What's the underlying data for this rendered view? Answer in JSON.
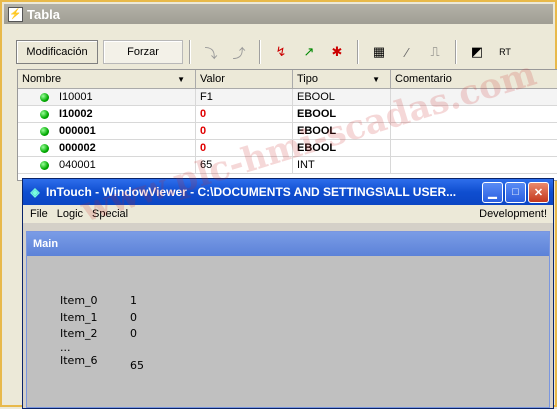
{
  "tabla": {
    "title": "Tabla",
    "toolbar": {
      "modificacion": "Modificación",
      "forzar": "Forzar"
    },
    "columns": [
      "Nombre",
      "Valor",
      "Tipo",
      "Comentario"
    ],
    "rows": [
      {
        "nombre": "I10001",
        "valor": "F1",
        "tipo": "EBOOL",
        "comentario": "",
        "bold": false,
        "red": false
      },
      {
        "nombre": "I10002",
        "valor": "0",
        "tipo": "EBOOL",
        "comentario": "",
        "bold": true,
        "red": true
      },
      {
        "nombre": "000001",
        "valor": "0",
        "tipo": "EBOOL",
        "comentario": "",
        "bold": true,
        "red": true
      },
      {
        "nombre": "000002",
        "valor": "0",
        "tipo": "EBOOL",
        "comentario": "",
        "bold": true,
        "red": true
      },
      {
        "nombre": "040001",
        "valor": "65",
        "tipo": "INT",
        "comentario": "",
        "bold": false,
        "red": false
      }
    ]
  },
  "intouch": {
    "title": "InTouch - WindowViewer - C:\\DOCUMENTS AND SETTINGS\\ALL USER...",
    "menu": [
      "File",
      "Logic",
      "Special"
    ],
    "menu_right": "Development!",
    "panel_title": "Main",
    "items": [
      {
        "label": "Item_0",
        "value": "1"
      },
      {
        "label": "Item_1",
        "value": "0"
      },
      {
        "label": "Item_2",
        "value": "0"
      },
      {
        "label": "...",
        "value": ""
      },
      {
        "label": "Item_6",
        "value": "65"
      }
    ]
  },
  "watermark": "www.plc-hmi-scadas.com",
  "colors": {
    "value_red": "#e00000",
    "title_blue": "#0F4ED0",
    "status_green": "#00aa00"
  }
}
